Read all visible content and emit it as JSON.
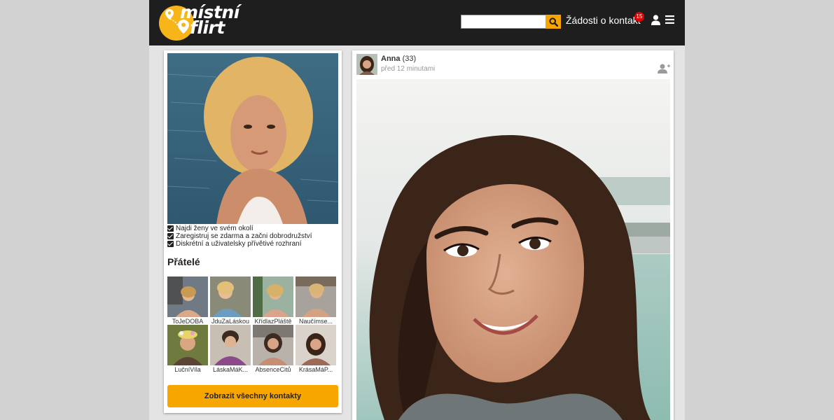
{
  "header": {
    "logo_line1": "místní",
    "logo_line2": "flirt",
    "search_placeholder": "",
    "contacts_label": "Žádosti o kontakt",
    "contacts_count": "15"
  },
  "profile": {
    "checks": [
      "Najdi ženy ve svém okolí",
      "Zaregistruj se zdarma a začni dobrodružství",
      "Diskrétní a uživatelsky přívětivé rozhraní"
    ],
    "friends_title": "Přátelé",
    "friends": [
      {
        "name": "ToJeDOBA"
      },
      {
        "name": "JduZaLáskou"
      },
      {
        "name": "KřídlazPláště"
      },
      {
        "name": "Naučímse..."
      },
      {
        "name": "LučníVíla"
      },
      {
        "name": "LáskaMáK..."
      },
      {
        "name": "AbsenceCitů"
      },
      {
        "name": "KrásaMáP..."
      }
    ],
    "show_all_label": "Zobrazit všechny kontakty"
  },
  "post": {
    "author_name": "Anna",
    "author_age": "(33)",
    "time": "před 12 minutami"
  },
  "colors": {
    "accent": "#f7a600",
    "logo_yellow": "#f7b51a",
    "header_bg": "#1e1e1e",
    "badge": "#e00000"
  },
  "icons": [
    "pin-icon",
    "search-icon",
    "user-icon",
    "menu-icon",
    "checkbox-icon",
    "add-friend-icon"
  ]
}
